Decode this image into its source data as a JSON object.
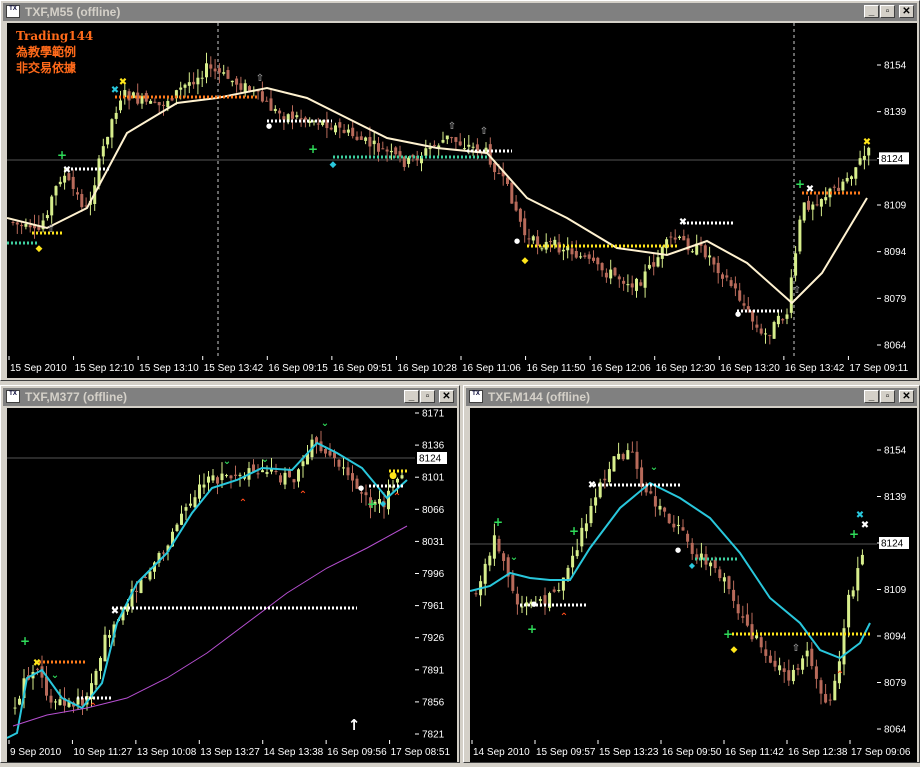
{
  "windows": [
    {
      "id": "m55",
      "title": "TXF,M55 (offline)",
      "annotation_lines": [
        "Trading144",
        "為教學範例",
        "非交易依據"
      ],
      "current_price": "8124",
      "y_ticks": [
        "8154",
        "8139",
        "8124",
        "8109",
        "8094",
        "8079",
        "8064"
      ],
      "x_ticks": [
        "15 Sep 2010",
        "15 Sep 12:10",
        "15 Sep 13:10",
        "15 Sep 13:42",
        "16 Sep 09:15",
        "16 Sep 09:51",
        "16 Sep 10:28",
        "16 Sep 11:06",
        "16 Sep 11:50",
        "16 Sep 12:06",
        "16 Sep 12:30",
        "16 Sep 13:20",
        "16 Sep 13:42",
        "17 Sep 09:11"
      ]
    },
    {
      "id": "m377",
      "title": "TXF,M377 (offline)",
      "current_price": "8124",
      "y_ticks": [
        "8171",
        "8136",
        "8101",
        "8066",
        "8031",
        "7996",
        "7961",
        "7926",
        "7891",
        "7856",
        "7821"
      ],
      "x_ticks": [
        "9 Sep 2010",
        "10 Sep 11:27",
        "13 Sep 10:08",
        "13 Sep 13:27",
        "14 Sep 13:38",
        "16 Sep 09:56",
        "17 Sep 08:51"
      ]
    },
    {
      "id": "m144",
      "title": "TXF,M144 (offline)",
      "current_price": "8124",
      "y_ticks": [
        "8154",
        "8139",
        "8124",
        "8109",
        "8094",
        "8079",
        "8064"
      ],
      "x_ticks": [
        "14 Sep 2010",
        "15 Sep 09:57",
        "15 Sep 13:23",
        "16 Sep 09:50",
        "16 Sep 11:42",
        "16 Sep 12:38",
        "17 Sep 09:06"
      ]
    }
  ],
  "colors": {
    "bull_candle": "#d7ee8c",
    "bear_candle": "#b86a5a",
    "ma_m55": "#fff2d0",
    "ma_m377": "#29c7dc",
    "ma_m377_slow": "#b64fd1",
    "ma_m144": "#29c7dc",
    "annotation": "#ff6a1a",
    "dotted_orange": "#ff7a1a",
    "dotted_yellow": "#ffe61a",
    "dotted_teal": "#3ecfa0",
    "dotted_white": "#ffffff"
  },
  "icons": [
    "chart-window-icon",
    "minimize-icon",
    "restore-icon",
    "close-icon",
    "up-arrow-icon"
  ]
}
